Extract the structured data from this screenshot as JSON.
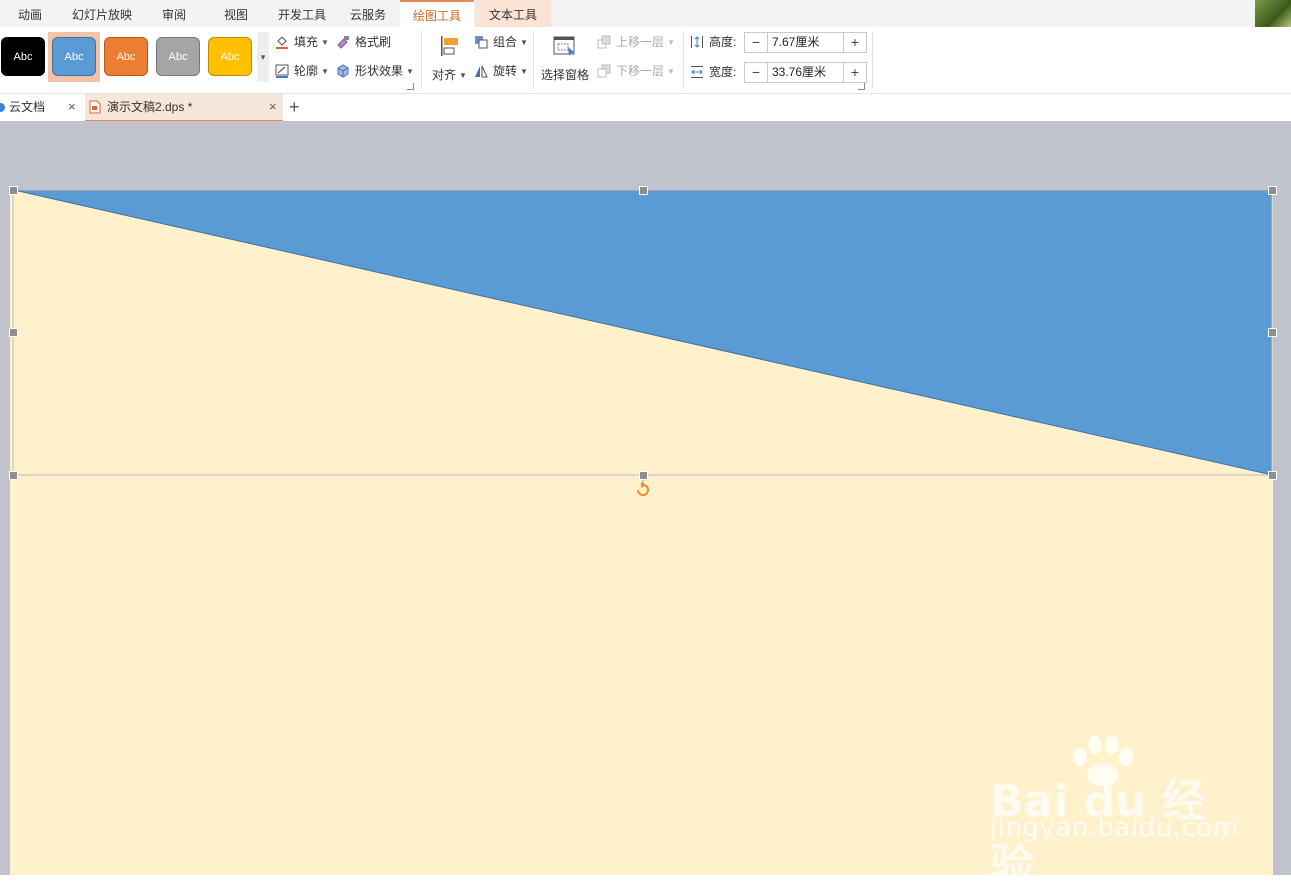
{
  "menu": {
    "tabs": [
      "动画",
      "幻灯片放映",
      "审阅",
      "视图",
      "开发工具",
      "云服务",
      "绘图工具",
      "文本工具"
    ],
    "active_tab": "绘图工具"
  },
  "ribbon": {
    "styles": [
      {
        "label": "Abc",
        "bg": "#000000",
        "fg": "#ffffff",
        "border": "#000000"
      },
      {
        "label": "Abc",
        "bg": "#5b9bd5",
        "fg": "#ffffff",
        "border": "#41719c"
      },
      {
        "label": "Abc",
        "bg": "#ed7d31",
        "fg": "#ffffff",
        "border": "#ae5a21"
      },
      {
        "label": "Abc",
        "bg": "#a5a5a5",
        "fg": "#ffffff",
        "border": "#787878"
      },
      {
        "label": "Abc",
        "bg": "#ffc000",
        "fg": "#ffffff",
        "border": "#bc8c00"
      }
    ],
    "fill": "填充",
    "format_painter": "格式刷",
    "outline": "轮廓",
    "shape_effects": "形状效果",
    "align": "对齐",
    "group": "组合",
    "rotate": "旋转",
    "selection_pane": "选择窗格",
    "bring_forward": "上移一层",
    "send_backward": "下移一层",
    "height_label": "高度:",
    "height_value": "7.67厘米",
    "width_label": "宽度:",
    "width_value": "33.76厘米",
    "minus": "−",
    "plus": "+"
  },
  "doc_tabs": {
    "cloud": "云文档",
    "file": "演示文稿2.dps *",
    "close": "×",
    "new": "+"
  },
  "slide": {
    "background": "#fff1cc",
    "shape_fill": "#5b9bd5",
    "shape": "right-triangle"
  },
  "watermark": {
    "logo": "Bai du 经验",
    "url": "jingyan.baidu.com"
  }
}
